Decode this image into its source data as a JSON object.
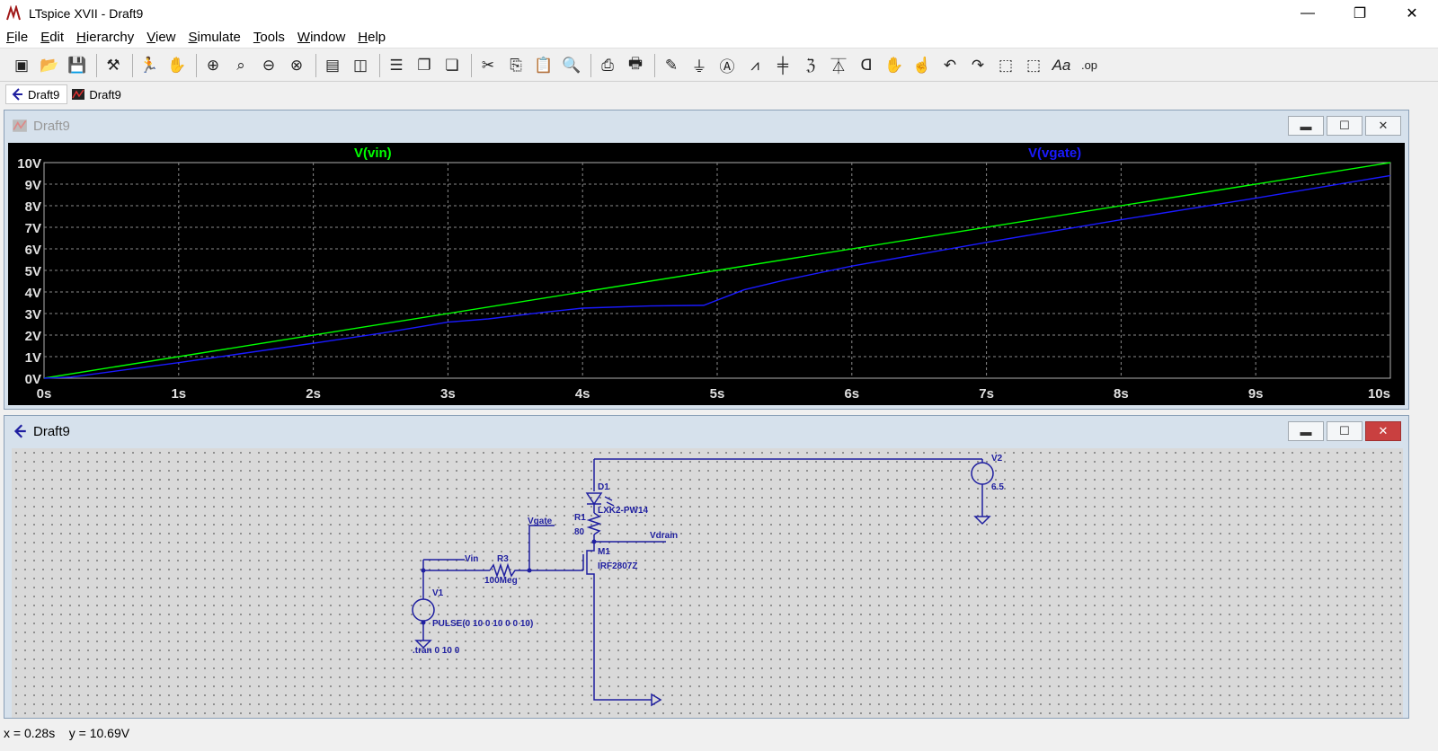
{
  "window": {
    "title": "LTspice XVII - Draft9"
  },
  "window_controls": {
    "minimize": "—",
    "restore": "❐",
    "close": "✕"
  },
  "menu": [
    {
      "key": "F",
      "rest": "ile"
    },
    {
      "key": "E",
      "rest": "dit"
    },
    {
      "key": "H",
      "rest": "ierarchy"
    },
    {
      "key": "V",
      "rest": "iew"
    },
    {
      "key": "S",
      "rest": "imulate"
    },
    {
      "key": "T",
      "rest": "ools"
    },
    {
      "key": "W",
      "rest": "indow"
    },
    {
      "key": "H",
      "rest": "elp"
    }
  ],
  "tabs": [
    {
      "label": "Draft9",
      "kind": "schematic"
    },
    {
      "label": "Draft9",
      "kind": "waveform"
    }
  ],
  "waveform_window": {
    "title": "Draft9",
    "chart_data": {
      "type": "line",
      "xlabel": "",
      "ylabel": "",
      "xlim": [
        0,
        10
      ],
      "ylim": [
        0,
        10
      ],
      "x_ticks": [
        "0s",
        "1s",
        "2s",
        "3s",
        "4s",
        "5s",
        "6s",
        "7s",
        "8s",
        "9s",
        "10s"
      ],
      "y_ticks": [
        "0V",
        "1V",
        "2V",
        "3V",
        "4V",
        "5V",
        "6V",
        "7V",
        "8V",
        "9V",
        "10V"
      ],
      "grid": true,
      "series": [
        {
          "name": "V(vin)",
          "color": "#00ff00",
          "x": [
            0,
            10
          ],
          "y": [
            0,
            10
          ]
        },
        {
          "name": "V(vgate)",
          "color": "#1a1aff",
          "x": [
            0,
            0.2,
            1,
            2,
            2.5,
            3,
            3.3,
            3.7,
            4,
            4.5,
            4.9,
            5.2,
            5.5,
            6,
            7,
            8,
            9,
            10
          ],
          "y": [
            0,
            0.05,
            0.72,
            1.62,
            2.08,
            2.6,
            2.75,
            3.05,
            3.25,
            3.35,
            3.38,
            4.1,
            4.55,
            5.2,
            6.3,
            7.35,
            8.35,
            9.4
          ]
        }
      ]
    }
  },
  "schematic_window": {
    "title": "Draft9",
    "labels": {
      "v2": "V2",
      "v2_value": "6.5",
      "d1": "D1",
      "d1_model": "LXK2-PW14",
      "r1": "R1",
      "r1_value": "80",
      "vgate": "Vgate",
      "vdrain": "Vdrain",
      "m1": "M1",
      "m1_model": "IRF2807Z",
      "vin": "Vin",
      "r3": "R3",
      "r3_value": "100Meg",
      "v1": "V1",
      "v1_value": "PULSE(0 10 0 10 0 0 10)",
      "tran": ".tran 0 10 0"
    }
  },
  "status": {
    "text": "x = 0.28s    y = 10.69V"
  },
  "colors": {
    "wire": "#1f1fa0",
    "component": "#1f1fa0",
    "plot_bg": "#000000",
    "grid": "#808080"
  }
}
